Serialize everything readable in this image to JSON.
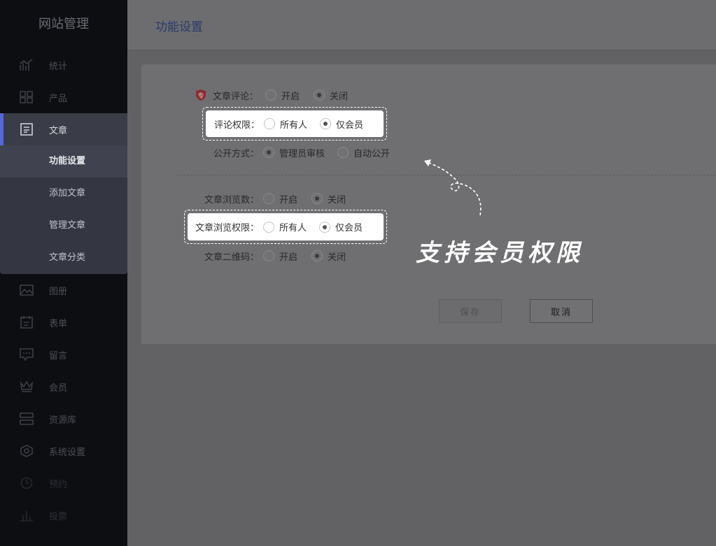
{
  "sidebar": {
    "brand": "网站管理",
    "items": [
      {
        "label": "统计",
        "icon": "chart-icon"
      },
      {
        "label": "产品",
        "icon": "grid-icon"
      },
      {
        "label": "文章",
        "icon": "article-icon"
      },
      {
        "label": "图册",
        "icon": "image-icon"
      },
      {
        "label": "表单",
        "icon": "form-icon"
      },
      {
        "label": "留言",
        "icon": "message-icon"
      },
      {
        "label": "会员",
        "icon": "crown-icon"
      },
      {
        "label": "资源库",
        "icon": "storage-icon"
      },
      {
        "label": "系统设置",
        "icon": "settings-icon"
      },
      {
        "label": "预约",
        "icon": "clock-icon"
      },
      {
        "label": "投票",
        "icon": "vote-icon"
      }
    ],
    "submenu": [
      "功能设置",
      "添加文章",
      "管理文章",
      "文章分类"
    ]
  },
  "header": {
    "title": "功能设置"
  },
  "form": {
    "badge": "专",
    "comment": {
      "label": "文章评论：",
      "opt_on": "开启",
      "opt_off": "关闭",
      "selected": "关闭"
    },
    "comment_perm": {
      "label": "评论权限：",
      "opt_all": "所有人",
      "opt_member": "仅会员",
      "selected": "仅会员"
    },
    "publish": {
      "label": "公开方式：",
      "opt_admin": "管理员审核",
      "opt_auto": "自动公开",
      "selected": "管理员审核"
    },
    "views": {
      "label": "文章浏览数：",
      "opt_on": "开启",
      "opt_off": "关闭",
      "selected": "关闭"
    },
    "view_perm": {
      "label": "文章浏览权限：",
      "opt_all": "所有人",
      "opt_member": "仅会员",
      "selected": "仅会员"
    },
    "qrcode": {
      "label": "文章二维码：",
      "opt_on": "开启",
      "opt_off": "关闭",
      "selected": "关闭"
    }
  },
  "buttons": {
    "save": "保存",
    "cancel": "取消"
  },
  "promo": {
    "text": "支持会员权限"
  },
  "colors": {
    "accent": "#5566d8",
    "sidebar_bg": "#0d0e12",
    "overlay": "#626264"
  }
}
